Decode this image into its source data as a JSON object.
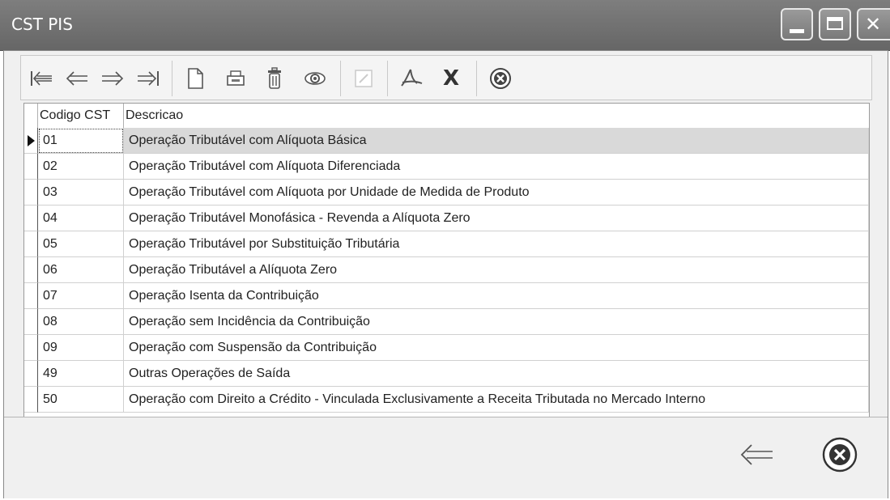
{
  "window": {
    "title": "CST PIS",
    "controls": [
      "minimize-icon",
      "maximize-icon",
      "close-icon"
    ]
  },
  "toolbar": {
    "buttons": [
      {
        "name": "first-record",
        "icon": "arrow-first-icon",
        "glyph": "⇤"
      },
      {
        "name": "previous-record",
        "icon": "arrow-left-icon",
        "glyph": "⇐"
      },
      {
        "name": "next-record",
        "icon": "arrow-right-icon",
        "glyph": "⇒"
      },
      {
        "name": "last-record",
        "icon": "arrow-last-icon",
        "glyph": "⇥"
      },
      {
        "name": "new-record",
        "icon": "new-document-icon",
        "glyph": ""
      },
      {
        "name": "print-record",
        "icon": "printer-icon",
        "glyph": ""
      },
      {
        "name": "delete-record",
        "icon": "trash-icon",
        "glyph": ""
      },
      {
        "name": "view-record",
        "icon": "eye-icon",
        "glyph": ""
      },
      {
        "name": "edit-record",
        "icon": "edit-icon",
        "glyph": ""
      },
      {
        "name": "export-pdf",
        "icon": "pdf-icon",
        "glyph": ""
      },
      {
        "name": "export-excel",
        "icon": "excel-icon",
        "glyph": "X"
      },
      {
        "name": "close-form",
        "icon": "close-circle-icon",
        "glyph": ""
      }
    ]
  },
  "grid": {
    "columns": [
      "Codigo CST",
      "Descricao"
    ],
    "selected_index": 0,
    "rows": [
      {
        "code": "01",
        "description": "Operação Tributável com Alíquota Básica"
      },
      {
        "code": "02",
        "description": "Operação Tributável com Alíquota Diferenciada"
      },
      {
        "code": "03",
        "description": "Operação Tributável com Alíquota por Unidade de Medida de Produto"
      },
      {
        "code": "04",
        "description": "Operação Tributável Monofásica - Revenda a Alíquota Zero"
      },
      {
        "code": "05",
        "description": "Operação Tributável por Substituição Tributária"
      },
      {
        "code": "06",
        "description": "Operação Tributável a Alíquota Zero"
      },
      {
        "code": "07",
        "description": "Operação Isenta da Contribuição"
      },
      {
        "code": "08",
        "description": "Operação sem Incidência da Contribuição"
      },
      {
        "code": "09",
        "description": "Operação com Suspensão da Contribuição"
      },
      {
        "code": "49",
        "description": "Outras Operações de Saída"
      },
      {
        "code": "50",
        "description": "Operação com Direito a Crédito - Vinculada Exclusivamente a Receita Tributada no Mercado Interno"
      }
    ]
  },
  "footer": {
    "back_icon": "arrow-left-icon",
    "close_icon": "close-circle-icon",
    "back_glyph": "⇐"
  },
  "colors": {
    "titlebar": "#707070",
    "selected_row": "#d9d9d9",
    "toolbar_icon": "#444444",
    "disabled_icon": "#c8c8c8"
  }
}
